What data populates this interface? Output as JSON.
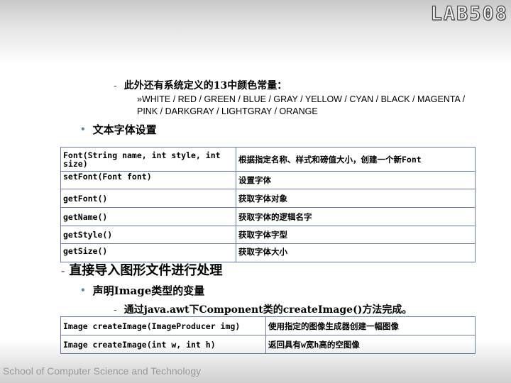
{
  "logo": "LAB508",
  "colors_line": {
    "dash": "-",
    "text": "此外还有系统定义的13中颜色常量：",
    "list": "»WHITE / RED / GREEN / BLUE / GRAY / YELLOW / CYAN / BLACK / MAGENTA / PINK / DARKGRAY / LIGHTGRAY / ORANGE"
  },
  "font_section": {
    "bullet": "•",
    "title": "文本字体设置"
  },
  "font_table": [
    {
      "method": "Font(String name, int style, int size)",
      "desc": "根据指定名称、样式和磅值大小，创建一个新Font"
    },
    {
      "method": "setFont(Font font)",
      "desc": "设置字体"
    },
    {
      "method": "getFont()",
      "desc": "获取字体对象"
    },
    {
      "method": "getName()",
      "desc": "获取字体的逻辑名字"
    },
    {
      "method": "getStyle()",
      "desc": "获取字体字型"
    },
    {
      "method": "getSize()",
      "desc": "获取字体大小"
    }
  ],
  "image_heading": {
    "dash": "-",
    "text": "直接导入图形文件进行处理"
  },
  "image_section": {
    "bullet": "•",
    "title": "声明Image类型的变量"
  },
  "image_line": {
    "dash": "-",
    "text": "通过java.awt下Component类的createImage()方法完成。"
  },
  "image_table": [
    {
      "method": "Image createImage(ImageProducer img)",
      "desc": "使用指定的图像生成器创建一幅图像"
    },
    {
      "method": "Image createImage(int w, int h)",
      "desc": "返回具有w宽h高的空图像"
    }
  ],
  "footer": "School of Computer Science and Technology"
}
